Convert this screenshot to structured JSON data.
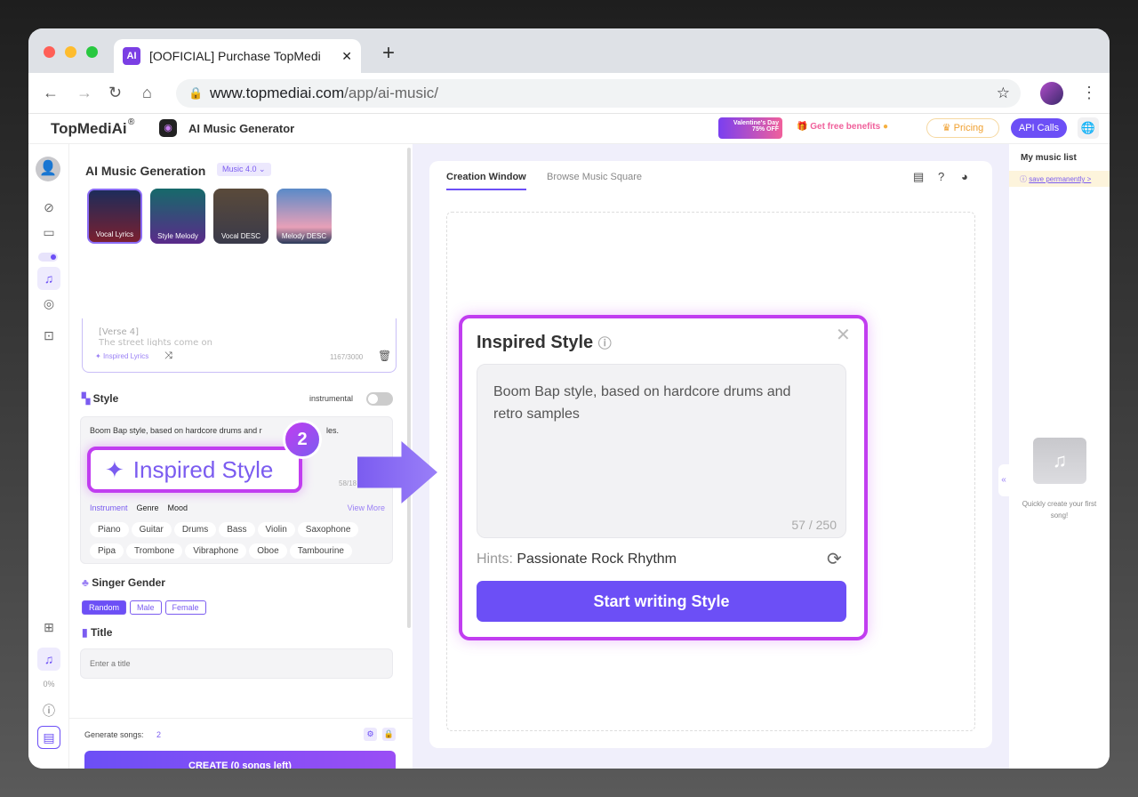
{
  "browser": {
    "tab_title": "[OOFICIAL] Purchase TopMedi",
    "favicon": "AI",
    "url_domain": "www.topmediai.com",
    "url_path": "/app/ai-music/"
  },
  "header": {
    "logo": "TopMediAi",
    "logo_mark": "®",
    "app_name": "AI Music Generator",
    "promo_line1": "Valentine's Day",
    "promo_line2": "75% OFF",
    "free_benefits": "Get free benefits",
    "pricing": "Pricing",
    "api_calls": "API Calls"
  },
  "rail": {
    "progress": "0%"
  },
  "left": {
    "title": "AI Music Generation",
    "model": "Music 4.0",
    "modes": [
      {
        "label": "Vocal Lyrics",
        "selected": true
      },
      {
        "label": "Style Melody"
      },
      {
        "label": "Vocal DESC"
      },
      {
        "label": "Melody DESC"
      }
    ],
    "lyrics_line1": "[Verse 4]",
    "lyrics_line2": "The street lights come on",
    "inspired_lyrics": "Inspired Lyrics",
    "lyrics_count": "1167/3000",
    "style_label": "Style",
    "instrumental": "instrumental",
    "instrumental_on": false,
    "style_text": "Boom Bap style, based on hardcore drums and r",
    "style_text_end": "les.",
    "style_count": "58/18",
    "callout_step": "2",
    "callout_label": "Inspired Style",
    "style_tabs": [
      "Instrument",
      "Genre",
      "Mood"
    ],
    "view_more": "View More",
    "instruments_row1": [
      "Piano",
      "Guitar",
      "Drums",
      "Bass",
      "Violin",
      "Saxophone"
    ],
    "instruments_row2": [
      "Pipa",
      "Trombone",
      "Vibraphone",
      "Oboe",
      "Tambourine"
    ],
    "singer_label": "Singer Gender",
    "genders": [
      "Random",
      "Male",
      "Female"
    ],
    "selected_gender": "Random",
    "title_label": "Title",
    "title_placeholder": "Enter a title",
    "generate_label": "Generate songs:",
    "generate_count": "2",
    "create_button": "CREATE (0 songs left)"
  },
  "main": {
    "tabs": [
      "Creation Window",
      "Browse Music Square"
    ],
    "active_tab": "Creation Window"
  },
  "dialog": {
    "title": "Inspired Style",
    "text": "Boom Bap style, based on hardcore drums and retro samples",
    "count": "57 / 250",
    "hints_label": "Hints:",
    "hint": "Passionate Rock Rhythm",
    "button": "Start writing Style"
  },
  "right": {
    "title": "My music list",
    "save": "save permanently >",
    "empty": "Quickly create your first song!"
  },
  "colors": {
    "accent": "#7b5cf0",
    "callout_border": "#c13df0",
    "button": "#6c4ff6"
  }
}
